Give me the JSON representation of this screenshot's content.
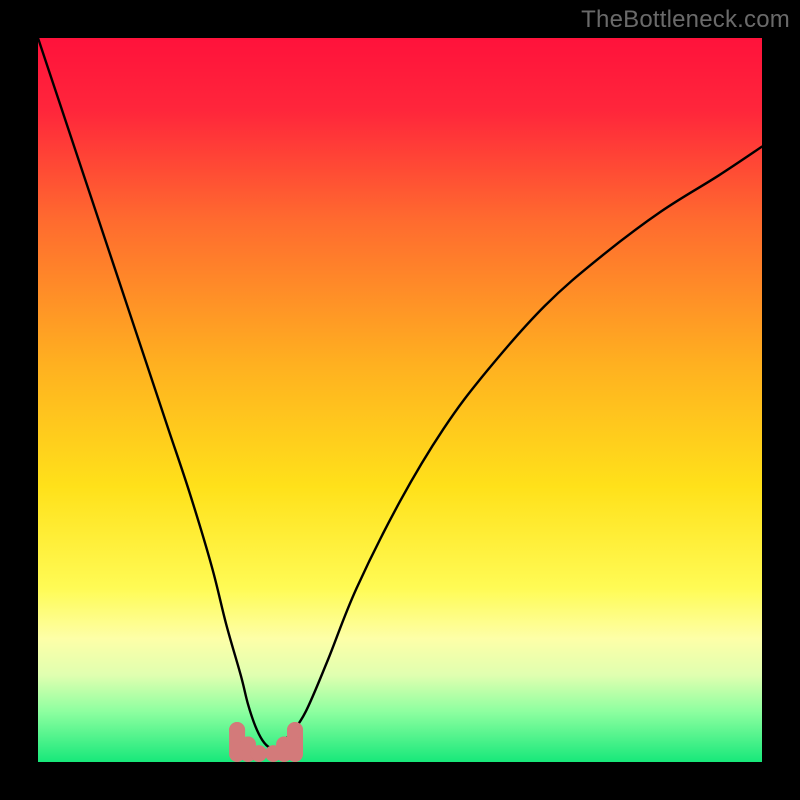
{
  "watermark": "TheBottleneck.com",
  "chart_data": {
    "type": "line",
    "title": "",
    "xlabel": "",
    "ylabel": "",
    "xlim": [
      0,
      100
    ],
    "ylim": [
      0,
      100
    ],
    "background_gradient": {
      "stops": [
        {
          "offset": 0.0,
          "color": "#ff123b"
        },
        {
          "offset": 0.1,
          "color": "#ff263b"
        },
        {
          "offset": 0.25,
          "color": "#ff6a2f"
        },
        {
          "offset": 0.45,
          "color": "#ffb020"
        },
        {
          "offset": 0.62,
          "color": "#ffe11a"
        },
        {
          "offset": 0.76,
          "color": "#fffb55"
        },
        {
          "offset": 0.83,
          "color": "#fdffa8"
        },
        {
          "offset": 0.88,
          "color": "#e0ffb0"
        },
        {
          "offset": 0.93,
          "color": "#8effa0"
        },
        {
          "offset": 1.0,
          "color": "#17e87a"
        }
      ]
    },
    "series": [
      {
        "name": "curve",
        "color": "#000000",
        "x": [
          0,
          3,
          6,
          9,
          12,
          15,
          18,
          21,
          24,
          26,
          28,
          29,
          30,
          31,
          32,
          33,
          34,
          35,
          37,
          40,
          44,
          50,
          56,
          62,
          70,
          78,
          86,
          94,
          100
        ],
        "values": [
          100,
          91,
          82,
          73,
          64,
          55,
          46,
          37,
          27,
          19,
          12,
          8,
          5,
          3,
          2,
          2,
          3,
          4,
          7,
          14,
          24,
          36,
          46,
          54,
          63,
          70,
          76,
          81,
          85
        ]
      }
    ],
    "markers": {
      "name": "dip-markers",
      "color": "#d37a7a",
      "radius": 8,
      "cap_height": 11,
      "points": [
        {
          "x": 27.5,
          "y": 4.0
        },
        {
          "x": 29.0,
          "y": 2.0
        },
        {
          "x": 30.5,
          "y": 0.8
        },
        {
          "x": 32.5,
          "y": 0.8
        },
        {
          "x": 34.0,
          "y": 2.0
        },
        {
          "x": 35.5,
          "y": 4.0
        }
      ]
    }
  }
}
